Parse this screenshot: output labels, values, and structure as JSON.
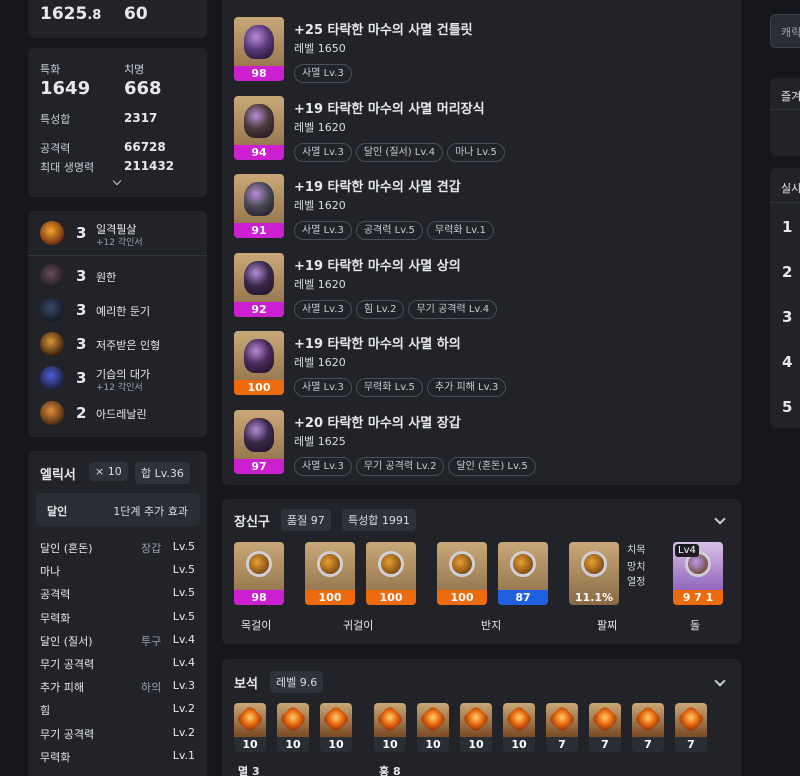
{
  "stats": {
    "top_left_int": "1625",
    "top_left_dec": ".8",
    "top_right": "60",
    "special_label": "특화",
    "special_value": "1649",
    "crit_label": "치명",
    "crit_value": "668",
    "trait_sum_label": "특성합",
    "trait_sum_value": "2317",
    "attack_label": "공격력",
    "attack_value": "66728",
    "max_hp_label": "최대 생명력",
    "max_hp_value": "211432"
  },
  "engravings": [
    {
      "count": "3",
      "name": "일격필살",
      "sub": "+12 각인서"
    },
    {
      "count": "3",
      "name": "원한",
      "sub": ""
    },
    {
      "count": "3",
      "name": "예리한 둔기",
      "sub": ""
    },
    {
      "count": "3",
      "name": "저주받은 인형",
      "sub": ""
    },
    {
      "count": "3",
      "name": "기습의 대가",
      "sub": "+12 각인서"
    },
    {
      "count": "2",
      "name": "아드레날린",
      "sub": ""
    }
  ],
  "elixir": {
    "title": "엘릭서",
    "count_badge": "× 10",
    "sum_badge": "합 Lv.36",
    "set_name": "달인",
    "set_effect": "1단계 추가 효과",
    "rows": [
      {
        "name": "달인 (혼돈)",
        "part": "장갑",
        "level": "Lv.5"
      },
      {
        "name": "마나",
        "part": "",
        "level": "Lv.5"
      },
      {
        "name": "공격력",
        "part": "",
        "level": "Lv.5"
      },
      {
        "name": "무력화",
        "part": "",
        "level": "Lv.5"
      },
      {
        "name": "달인 (질서)",
        "part": "투구",
        "level": "Lv.4"
      },
      {
        "name": "무기 공격력",
        "part": "",
        "level": "Lv.4"
      },
      {
        "name": "추가 피해",
        "part": "하의",
        "level": "Lv.3"
      },
      {
        "name": "힘",
        "part": "",
        "level": "Lv.2"
      },
      {
        "name": "무기 공격력",
        "part": "",
        "level": "Lv.2"
      },
      {
        "name": "무력화",
        "part": "",
        "level": "Lv.1"
      }
    ]
  },
  "equipment": [
    {
      "quality": "98",
      "name": "+25 타락한 마수의 사멸 건틀릿",
      "level": "레벨 1650",
      "tags": [
        "사멸 Lv.3"
      ]
    },
    {
      "quality": "94",
      "name": "+19 타락한 마수의 사멸 머리장식",
      "level": "레벨 1620",
      "tags": [
        "사멸 Lv.3",
        "달인 (질서) Lv.4",
        "마나 Lv.5"
      ]
    },
    {
      "quality": "91",
      "name": "+19 타락한 마수의 사멸 견갑",
      "level": "레벨 1620",
      "tags": [
        "사멸 Lv.3",
        "공격력 Lv.5",
        "무력화 Lv.1"
      ]
    },
    {
      "quality": "92",
      "name": "+19 타락한 마수의 사멸 상의",
      "level": "레벨 1620",
      "tags": [
        "사멸 Lv.3",
        "힘 Lv.2",
        "무기 공격력 Lv.4"
      ]
    },
    {
      "quality": "100",
      "name": "+19 타락한 마수의 사멸 하의",
      "level": "레벨 1620",
      "tags": [
        "사멸 Lv.3",
        "무력화 Lv.5",
        "추가 피해 Lv.3"
      ]
    },
    {
      "quality": "97",
      "name": "+20 타락한 마수의 사멸 장갑",
      "level": "레벨 1625",
      "tags": [
        "사멸 Lv.3",
        "무기 공격력 Lv.2",
        "달인 (혼돈) Lv.5"
      ]
    }
  ],
  "accessories": {
    "title": "장신구",
    "quality_badge": "품질 97",
    "trait_badge": "특성합 1991",
    "items": [
      {
        "q": "98"
      },
      {
        "q": "100"
      },
      {
        "q": "100"
      },
      {
        "q": "100"
      },
      {
        "q": "87"
      },
      {
        "q": "11.1%"
      },
      {
        "q": "9 7 1",
        "lv": "Lv4"
      }
    ],
    "bracelet_opts": [
      "치목",
      "망치",
      "열정"
    ],
    "labels": [
      "목걸이",
      "귀걸이",
      "반지",
      "팔찌",
      "돌"
    ]
  },
  "gems": {
    "title": "보석",
    "level_badge": "레벨 9.6",
    "levels": [
      "10",
      "10",
      "10",
      "10",
      "10",
      "10",
      "10",
      "7",
      "7",
      "7",
      "7"
    ],
    "footer_left": "멸 3",
    "footer_right": "홍 8"
  },
  "right_panel": {
    "input_text": "캐릭",
    "fav_label": "즐겨",
    "live_label": "실시",
    "ranks": [
      "1",
      "2",
      "3",
      "4",
      "5"
    ]
  },
  "colors": {
    "bg": "#15171c",
    "panel": "#212329",
    "magenta": "#cc1fd0",
    "orange": "#ee6a0e",
    "blue": "#1f5fe0"
  }
}
